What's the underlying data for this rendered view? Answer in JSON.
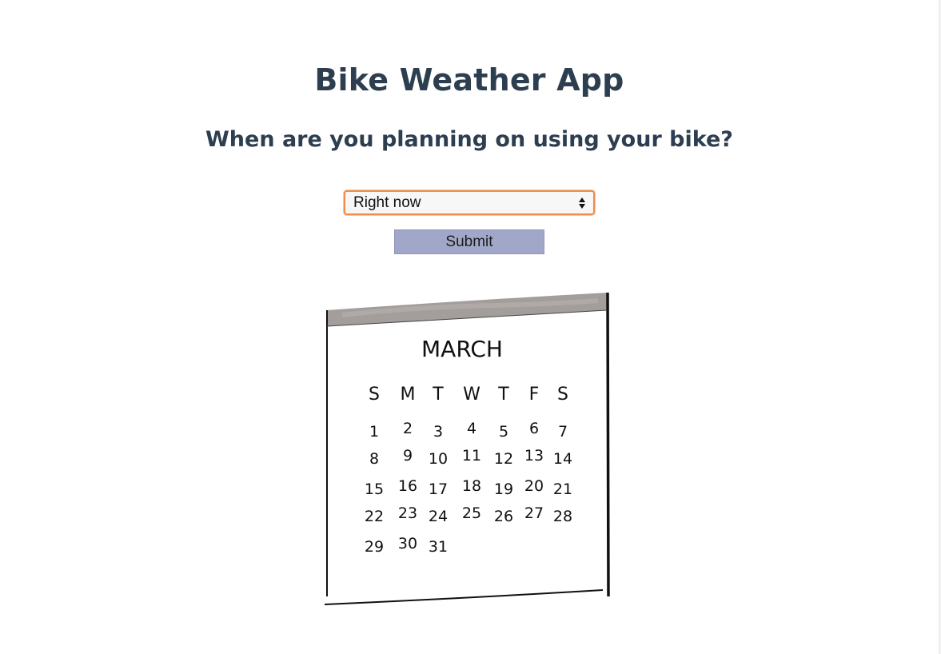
{
  "app": {
    "title": "Bike Weather App",
    "question": "When are you planning on using your bike?"
  },
  "form": {
    "time_select": {
      "selected": "Right now"
    },
    "submit_label": "Submit"
  },
  "calendar": {
    "month": "MARCH",
    "weekdays": [
      "S",
      "M",
      "T",
      "W",
      "T",
      "F",
      "S"
    ],
    "weeks": [
      [
        "1",
        "2",
        "3",
        "4",
        "5",
        "6",
        "7"
      ],
      [
        "8",
        "9",
        "10",
        "11",
        "12",
        "13",
        "14"
      ],
      [
        "15",
        "16",
        "17",
        "18",
        "19",
        "20",
        "21"
      ],
      [
        "22",
        "23",
        "24",
        "25",
        "26",
        "27",
        "28"
      ],
      [
        "29",
        "30",
        "31"
      ]
    ]
  },
  "colors": {
    "heading": "#2c3e50",
    "select_focus_border": "#f08c4a",
    "submit_background": "#a1a7c8",
    "calendar_header_band": "#a39d9b"
  }
}
